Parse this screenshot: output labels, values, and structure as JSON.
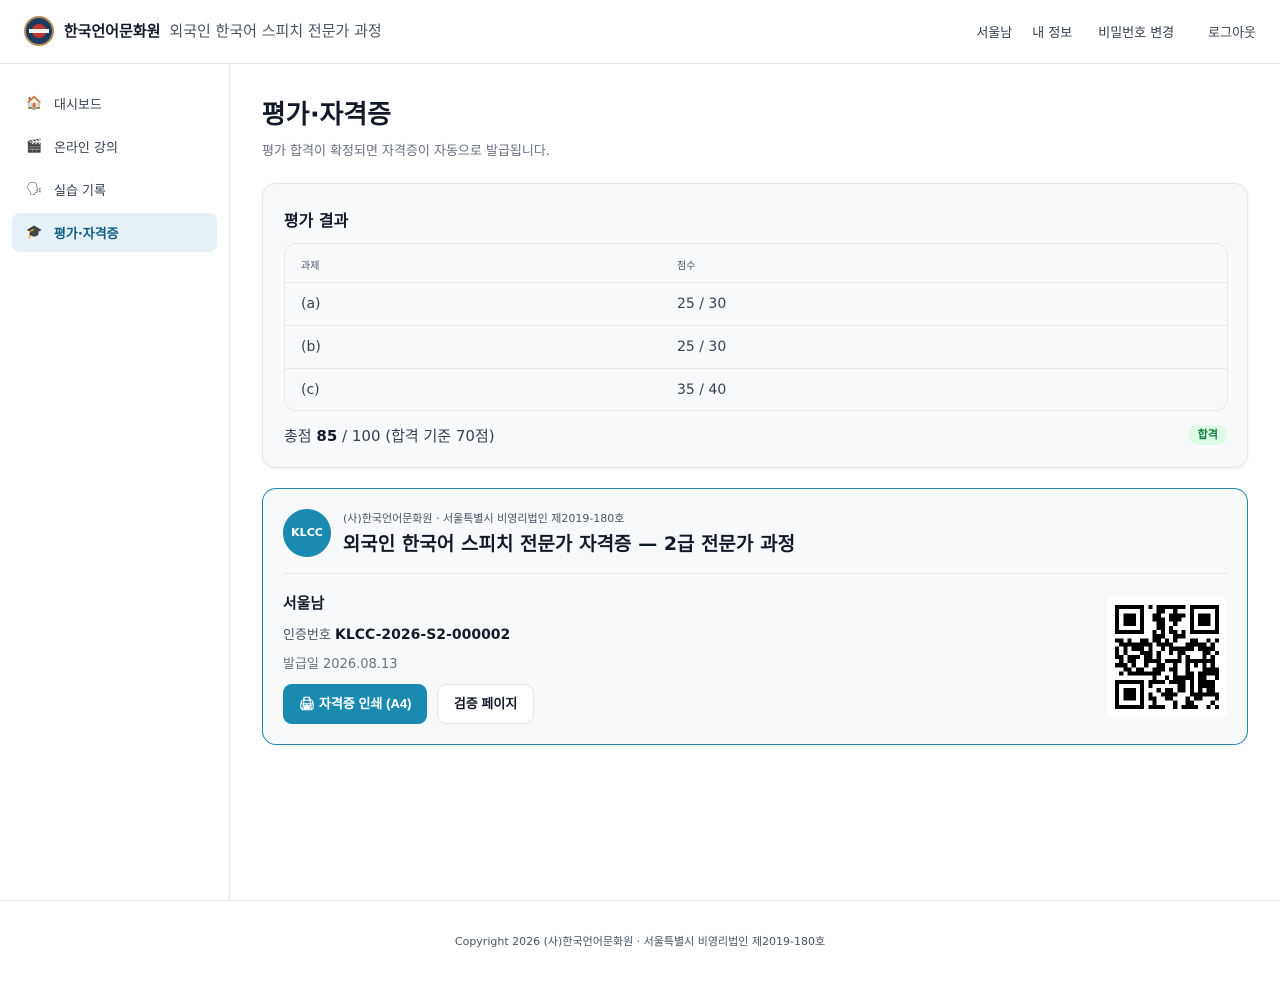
{
  "header": {
    "org_name": "한국언어문화원",
    "course_name": "외국인 한국어 스피치 전문가 과정",
    "nav": {
      "user": "서울남",
      "my_info": "내 정보",
      "change_password": "비밀번호 변경",
      "logout": "로그아웃"
    }
  },
  "sidebar": {
    "items": [
      {
        "label": "대시보드",
        "icon": "house-icon"
      },
      {
        "label": "온라인 강의",
        "icon": "clapperboard-icon"
      },
      {
        "label": "실습 기록",
        "icon": "speech-icon"
      },
      {
        "label": "평가·자격증",
        "icon": "graduation-cap-icon"
      }
    ]
  },
  "page": {
    "title": "평가·자격증",
    "subtitle": "평가 합격이 확정되면 자격증이 자동으로 발급됩니다."
  },
  "results": {
    "title": "평가 결과",
    "columns": [
      "과제",
      "점수"
    ],
    "rows": [
      {
        "task": "(a)",
        "score": "25 / 30"
      },
      {
        "task": "(b)",
        "score": "25 / 30"
      },
      {
        "task": "(c)",
        "score": "35 / 40"
      }
    ],
    "total_prefix": "총점",
    "total_score": "85",
    "total_suffix": "/ 100 (합격 기준 70점)",
    "status": "합격",
    "status_color": "#15803d"
  },
  "certificate": {
    "seal_text": "KLCC",
    "issuer": "(사)한국언어문화원 · 서울특별시 비영리법인 제2019-180호",
    "title": "외국인 한국어 스피치 전문가 자격증 — 2급 전문가 과정",
    "holder": "서울남",
    "number_label": "인증번호",
    "number": "KLCC-2026-S2-000002",
    "issued_label": "발급일",
    "issued_date": "2026.08.13",
    "print_button": "자격증 인쇄 (A4)",
    "print_icon": "printer-icon",
    "verify_button": "검증 페이지",
    "accent_color": "#1a8ab0"
  },
  "footer": {
    "copyright": "Copyright 2026 (사)한국언어문화원 · 서울특별시 비영리법인 제2019-180호"
  }
}
